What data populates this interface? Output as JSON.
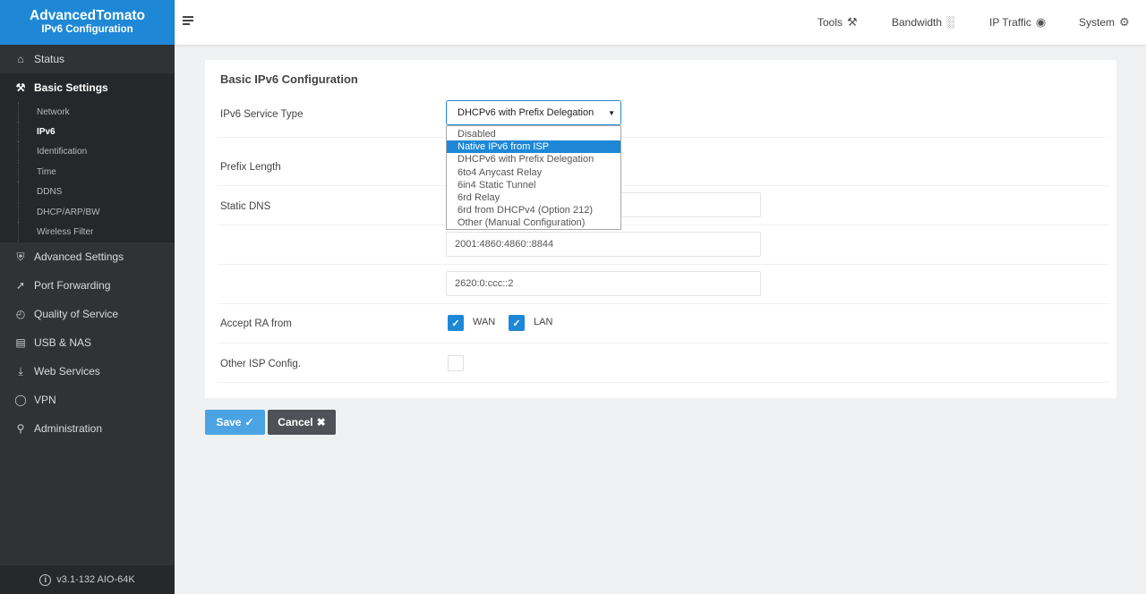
{
  "brand": {
    "title": "AdvancedTomato",
    "subtitle": "IPv6 Configuration",
    "color": "#1e88d7"
  },
  "sidebar": {
    "items": [
      {
        "label": "Status",
        "icon": "home-icon"
      },
      {
        "label": "Basic Settings",
        "icon": "tools-icon"
      },
      {
        "label": "Advanced Settings",
        "icon": "shield-icon"
      },
      {
        "label": "Port Forwarding",
        "icon": "forward-arrow-icon"
      },
      {
        "label": "Quality of Service",
        "icon": "gauge-icon"
      },
      {
        "label": "USB & NAS",
        "icon": "drive-icon"
      },
      {
        "label": "Web Services",
        "icon": "download-icon"
      },
      {
        "label": "VPN",
        "icon": "globe-icon"
      },
      {
        "label": "Administration",
        "icon": "wrench-icon"
      }
    ],
    "submenu": [
      "Network",
      "IPv6",
      "Identification",
      "Time",
      "DDNS",
      "DHCP/ARP/BW",
      "Wireless Filter"
    ],
    "current_submenu": "IPv6",
    "version": "v3.1-132 AIO-64K"
  },
  "topbar": {
    "links": [
      {
        "label": "Tools",
        "icon": "tools-icon"
      },
      {
        "label": "Bandwidth",
        "icon": "bar-chart-icon"
      },
      {
        "label": "IP Traffic",
        "icon": "globe-icon"
      },
      {
        "label": "System",
        "icon": "gears-icon"
      }
    ]
  },
  "panel": {
    "title": "Basic IPv6 Configuration",
    "labels": {
      "service_type": "IPv6 Service Type",
      "prefix_length": "Prefix Length",
      "static_dns": "Static DNS",
      "accept_ra": "Accept RA from",
      "other_isp": "Other ISP Config."
    },
    "service_type_value": "DHCPv6 with Prefix Delegation",
    "service_type_options": [
      "Disabled",
      "Native IPv6 from ISP",
      "DHCPv6 with Prefix Delegation",
      "6to4 Anycast Relay",
      "6in4 Static Tunnel",
      "6rd Relay",
      "6rd from DHCPv4 (Option 212)",
      "Other (Manual Configuration)"
    ],
    "highlighted_option": "Native IPv6 from ISP",
    "dns": [
      "",
      "2001:4860:4860::8844",
      "2620:0:ccc::2"
    ],
    "accept_ra": {
      "wan_label": "WAN",
      "wan_checked": true,
      "lan_label": "LAN",
      "lan_checked": true
    },
    "other_isp_checked": false
  },
  "buttons": {
    "save": "Save",
    "cancel": "Cancel"
  }
}
